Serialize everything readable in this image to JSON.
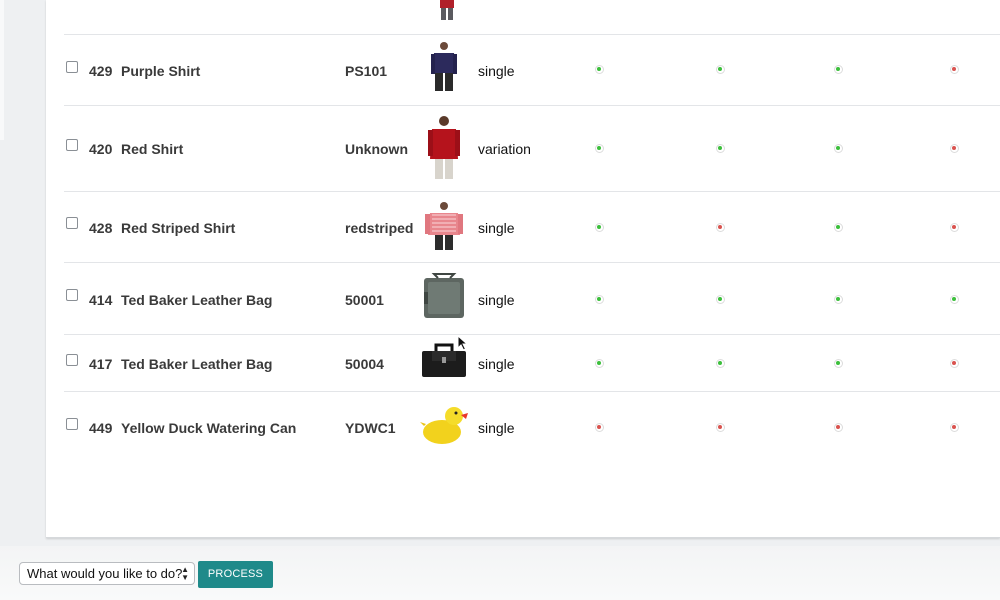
{
  "products": [
    {
      "id": "429",
      "name": "Purple Shirt",
      "sku": "PS101",
      "type": "single",
      "image": "purple-shirt-photo",
      "statuses": [
        "ok",
        "ok",
        "ok",
        "bad"
      ]
    },
    {
      "id": "420",
      "name": "Red Shirt",
      "sku": "Unknown",
      "type": "variation",
      "image": "red-shirt-photo",
      "statuses": [
        "ok",
        "ok",
        "ok",
        "bad"
      ]
    },
    {
      "id": "428",
      "name": "Red Striped Shirt",
      "sku": "redstriped",
      "type": "single",
      "image": "red-striped-shirt-photo",
      "statuses": [
        "ok",
        "bad",
        "ok",
        "bad"
      ]
    },
    {
      "id": "414",
      "name": "Ted Baker Leather Bag",
      "sku": "50001",
      "type": "single",
      "image": "grey-leather-bag-photo",
      "statuses": [
        "ok",
        "ok",
        "ok",
        "ok"
      ]
    },
    {
      "id": "417",
      "name": "Ted Baker Leather Bag",
      "sku": "50004",
      "type": "single",
      "image": "black-leather-bag-photo",
      "statuses": [
        "ok",
        "ok",
        "ok",
        "bad"
      ]
    },
    {
      "id": "449",
      "name": "Yellow Duck Watering Can",
      "sku": "YDWC1",
      "type": "single",
      "image": "yellow-duck-can-photo",
      "statuses": [
        "bad",
        "bad",
        "bad",
        "bad"
      ]
    }
  ],
  "status_colors": {
    "ok": "#3cbf3c",
    "bad": "#d9534f"
  },
  "bulk_action": {
    "select_value": "What would you like to do?",
    "process_label": "PROCESS"
  },
  "accent_color": "#1f8a8a"
}
